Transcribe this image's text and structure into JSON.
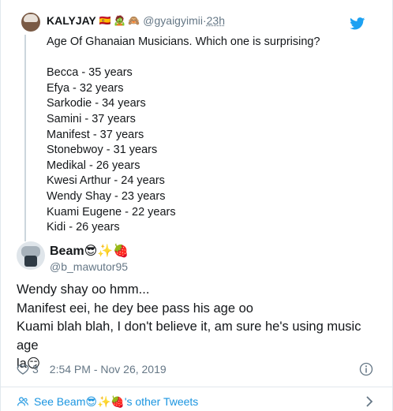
{
  "quoted": {
    "name": "KALYJAY",
    "name_emojis": "🇪🇸 🧟 🙈",
    "handle": "@gyaigyimii",
    "separator": " · ",
    "time": "23h",
    "lines": [
      "Age Of Ghanaian Musicians. Which one is surprising?",
      "",
      "Becca - 35 years",
      "Efya - 32 years",
      "Sarkodie - 34 years",
      "Samini - 37 years",
      "Manifest - 37 years",
      "Stonebwoy - 31 years",
      "Medikal - 26 years",
      "Kwesi Arthur - 24 years",
      "Wendy Shay - 23 years",
      "Kuami Eugene - 22 years",
      "Kidi - 26 years"
    ]
  },
  "tweet": {
    "display_name": "Beam😎✨🍓",
    "handle": "@b_mawutor95",
    "lines": [
      "Wendy shay oo hmm...",
      "Manifest eei, he dey bee pass his age oo",
      "Kuami blah blah, I don't believe it, am sure he's using music age",
      "la😏"
    ],
    "likes": "3",
    "timestamp": "2:54 PM - Nov 26, 2019"
  },
  "footer": {
    "link_text": "See Beam😎✨🍓's other Tweets"
  },
  "colors": {
    "text": "#14171a",
    "secondary": "#657786",
    "link": "#1b95e0",
    "twitter_blue": "#1da1f2",
    "border": "#e1e8ed"
  },
  "icons": [
    "twitter-bird-icon",
    "heart-icon",
    "info-icon",
    "people-icon",
    "chevron-right-icon"
  ]
}
